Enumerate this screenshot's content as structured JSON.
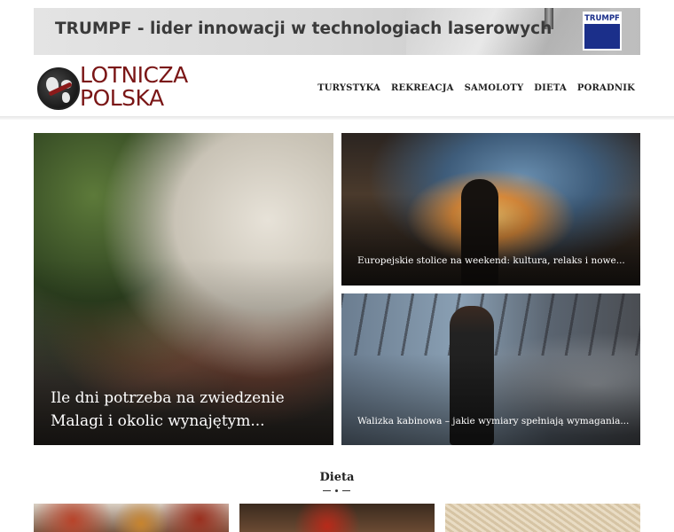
{
  "ad": {
    "text": "TRUMPF - lider innowacji w technologiach laserowych",
    "logo_text": "TRUMPF"
  },
  "logo": {
    "line1": "LOTNICZA",
    "line2": "POLSKA"
  },
  "nav": {
    "items": [
      "Turystyka",
      "Rekreacja",
      "Samoloty",
      "Dieta",
      "Poradnik"
    ]
  },
  "featured": [
    {
      "title": "Ile dni potrzeba na zwiedzenie Malagi i okolic wynajętym..."
    },
    {
      "title": "Europejskie stolice na weekend: kultura, relaks i nowe..."
    },
    {
      "title": "Walizka kabinowa – jakie wymiary spełniają wymagania..."
    }
  ],
  "section": {
    "title": "Dieta"
  },
  "colors": {
    "brand": "#7a1616",
    "ad_logo": "#1b2f8a"
  }
}
